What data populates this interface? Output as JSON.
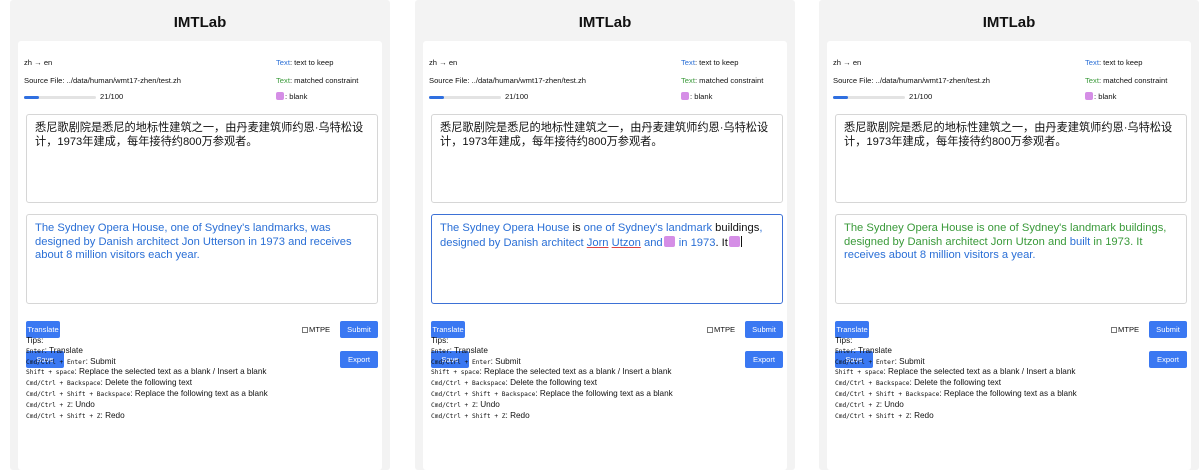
{
  "app_title": "IMTLab",
  "language_pair": "zh → en",
  "source_file_label": "Source File: ../data/human/wmt17-zhen/test.zh",
  "progress": {
    "current": 21,
    "total": 100,
    "text": "21/100",
    "fraction": 0.21
  },
  "legend": {
    "text_to_keep_key": "Text",
    "text_to_keep_val": ": text to keep",
    "matched_constraint_key": "Text",
    "matched_constraint_val": ": matched constraint",
    "blank_val": ": blank"
  },
  "source_text": "悉尼歌剧院是悉尼的地标性建筑之一，由丹麦建筑师约恩·乌特松设计，1973年建成，每年接待约800万参观者。",
  "panels": [
    {
      "translation_segments": [
        {
          "text": "The Sydney Opera House, one of Sydney's landmarks, was designed by Danish architect Jon Utterson in 1973 and receives about 8 million visitors each year.",
          "style": "blue"
        }
      ]
    },
    {
      "translation_segments": [
        {
          "text": "The Sydney Opera House",
          "style": "blue"
        },
        {
          "text": " is ",
          "style": "black"
        },
        {
          "text": "one of Sydney's landmark",
          "style": "blue"
        },
        {
          "text": " buildings",
          "style": "black"
        },
        {
          "text": ",",
          "style": "blue"
        },
        {
          "text": " designed by Danish architect ",
          "style": "blue"
        },
        {
          "text": "Jorn",
          "style": "blue-ul"
        },
        {
          "text": " ",
          "style": "blue"
        },
        {
          "text": "Utzon",
          "style": "blue-ul"
        },
        {
          "text": " and",
          "style": "blue"
        },
        {
          "text": "",
          "style": "blank"
        },
        {
          "text": " in 1973",
          "style": "blue"
        },
        {
          "text": ". It",
          "style": "black"
        },
        {
          "text": "",
          "style": "blank"
        },
        {
          "text": "",
          "style": "caret"
        }
      ]
    },
    {
      "translation_segments": [
        {
          "text": "The Sydney Opera House is one of Sydney's landmark buildings, designed by Danish architect Jorn Utzon and ",
          "style": "green"
        },
        {
          "text": "built",
          "style": "blue"
        },
        {
          "text": " in 1973. It ",
          "style": "green"
        },
        {
          "text": "receives about 8 million visitors a year.",
          "style": "blue"
        }
      ]
    }
  ],
  "buttons": {
    "translate": "Translate",
    "submit": "Submit",
    "save": "Save",
    "export": "Export"
  },
  "mtpe_label": "MTPE",
  "tips": {
    "heading": "Tips:",
    "items": [
      {
        "key": "Enter",
        "desc": ": Translate"
      },
      {
        "key": "Cmd/Ctrl + Enter",
        "desc": ": Submit"
      },
      {
        "key": "Shift + space",
        "desc": ": Replace the selected text as a blank / Insert a blank"
      },
      {
        "key": "Cmd/Ctrl + Backspace",
        "desc": ": Delete the following text"
      },
      {
        "key": "Cmd/Ctrl + Shift + Backspace",
        "desc": ": Replace the following text as a blank"
      },
      {
        "key": "Cmd/Ctrl + Z",
        "desc": ": Undo"
      },
      {
        "key": "Cmd/Ctrl + Shift + Z",
        "desc": ": Redo"
      }
    ]
  },
  "colors": {
    "accent_blue": "#3a78f2",
    "text_to_keep": "#2a6fd6",
    "matched_constraint": "#3a9a3a",
    "blank": "#d58ee6"
  },
  "icons": {
    "mtpe_checkbox": "checkbox-unchecked-icon",
    "blank_swatch": "blank-swatch-icon"
  }
}
